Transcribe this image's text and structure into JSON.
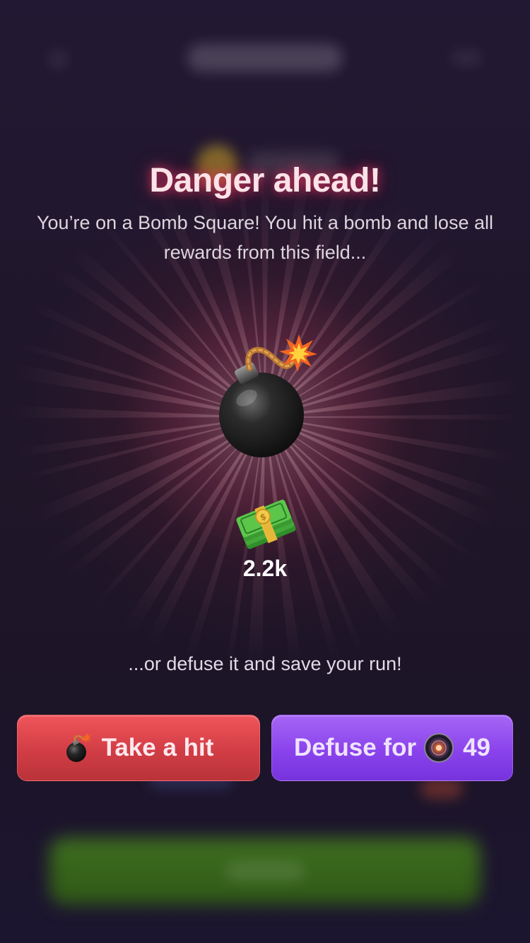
{
  "modal": {
    "title": "Danger ahead!",
    "message": "You’re on a Bomb Square! You hit a bomb and lose all rewards from this field...",
    "reward_amount": "2.2k",
    "defuse_hint": "...or defuse it and save your run!"
  },
  "actions": {
    "take_hit_label": "Take a hit",
    "defuse_label": "Defuse for",
    "defuse_cost": "49"
  },
  "icons": {
    "hero": "bomb-icon",
    "reward": "money-stack-icon",
    "take_hit": "bomb-icon",
    "defuse_currency": "coin-icon"
  },
  "colors": {
    "title_glow": "#ff3c6e",
    "take_hit_button": "#e0474e",
    "defuse_button": "#8a43ec",
    "background": "#1b1428"
  }
}
